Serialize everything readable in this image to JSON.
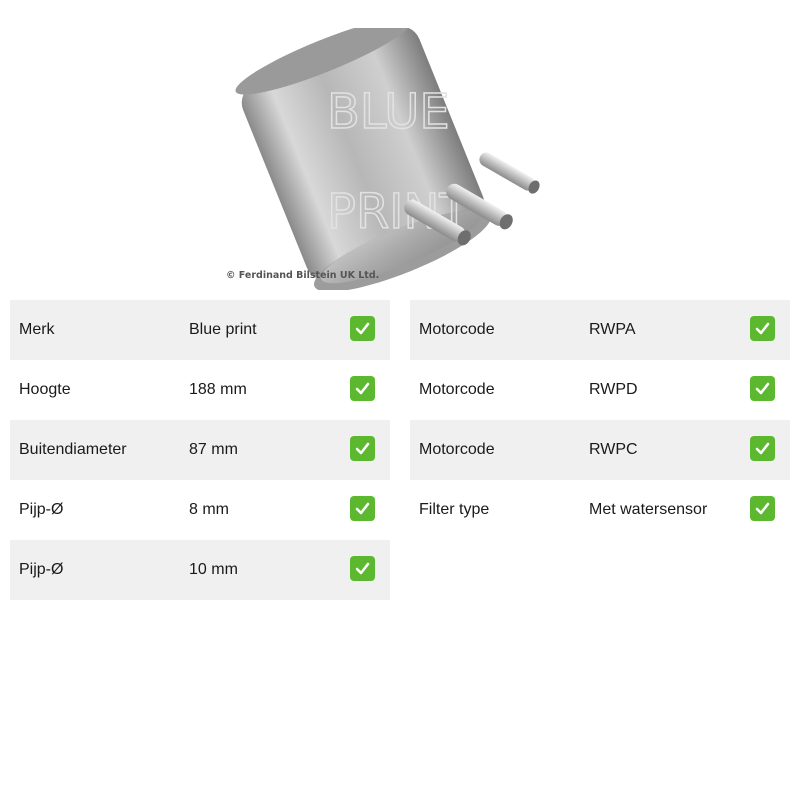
{
  "product": {
    "image_icon": "fuel-filter-photo",
    "brand_watermark": "BLUE PRINT",
    "copyright": "© Ferdinand Bilstein UK Ltd."
  },
  "specs_left": [
    {
      "label": "Merk",
      "value": "Blue print",
      "shaded": true
    },
    {
      "label": "Hoogte",
      "value": "188 mm",
      "shaded": false
    },
    {
      "label": "Buitendiameter",
      "value": "87 mm",
      "shaded": true
    },
    {
      "label": "Pijp-Ø",
      "value": "8 mm",
      "shaded": false
    },
    {
      "label": "Pijp-Ø",
      "value": "10 mm",
      "shaded": true
    }
  ],
  "specs_right": [
    {
      "label": "Motorcode",
      "value": "RWPA",
      "shaded": true
    },
    {
      "label": "Motorcode",
      "value": "RWPD",
      "shaded": false
    },
    {
      "label": "Motorcode",
      "value": "RWPC",
      "shaded": true
    },
    {
      "label": "Filter type",
      "value": "Met watersensor",
      "shaded": false
    }
  ],
  "icons": {
    "check": "check-mark-icon"
  },
  "colors": {
    "check_green": "#5cb82e",
    "row_shade": "#f0f0f0"
  }
}
